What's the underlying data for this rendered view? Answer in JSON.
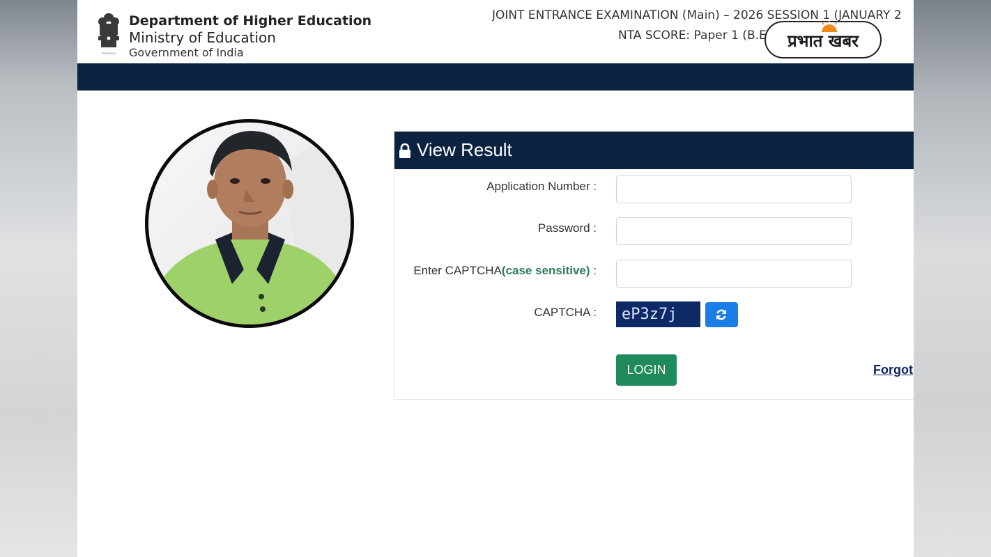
{
  "header": {
    "department": "Department of Higher Education",
    "ministry": "Ministry of Education",
    "government": "Government of India",
    "exam_title": "JOINT ENTRANCE EXAMINATION (Main) – 2026 SESSION 1 (JANUARY 2",
    "score_title": "NTA SCORE: Paper 1 (B.E",
    "watermark_logo": "प्रभात खबर"
  },
  "result_panel": {
    "title": "View Result",
    "application_label": "Application Number :",
    "password_label": "Password :",
    "captcha_entry_label": "Enter CAPTCHA",
    "captcha_case_note": "(case sensitive)",
    "captcha_entry_suffix": " :",
    "captcha_label": "CAPTCHA :",
    "captcha_value": "eP3z7j",
    "login_label": "LOGIN",
    "forgot_label": "Forgot"
  },
  "colors": {
    "navy": "#0b2340",
    "login_green": "#1f8a5b",
    "refresh_blue": "#1a7ee6",
    "case_note_green": "#2e7d5a"
  }
}
